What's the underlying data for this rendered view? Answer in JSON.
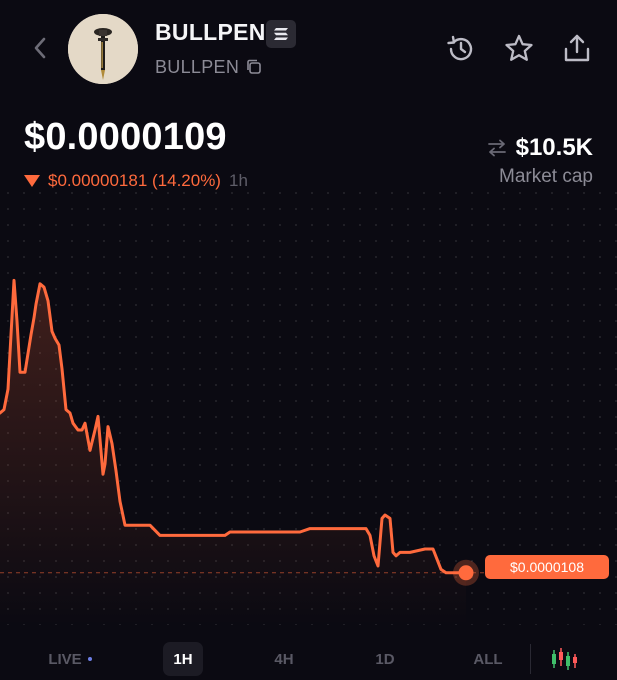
{
  "header": {
    "token_name": "BULLPEN",
    "token_symbol": "BULLPEN",
    "icons": [
      "back-chevron-icon",
      "chain-badge-icon",
      "copy-icon",
      "history-icon",
      "star-icon",
      "share-icon"
    ]
  },
  "price": {
    "current": "$0.0000109",
    "change": "$0.00000181 (14.20%)",
    "timeframe": "1h",
    "direction": "down"
  },
  "market_cap": {
    "value": "$10.5K",
    "label": "Market cap"
  },
  "chart": {
    "last_price_label": "$0.0000108",
    "line_color": "#ff6a3d"
  },
  "chart_data": {
    "type": "line",
    "title": "",
    "xlabel": "",
    "ylabel": "",
    "x": [
      0,
      4,
      8,
      11,
      14,
      17,
      20,
      25,
      31,
      34,
      36,
      40,
      44,
      48,
      52,
      55,
      59,
      62,
      66,
      70,
      73,
      78,
      82,
      85,
      90,
      95,
      98,
      103,
      105,
      108,
      112,
      116,
      120,
      125,
      130,
      150,
      160,
      170,
      200,
      225,
      230,
      245,
      300,
      310,
      366,
      370,
      374,
      378,
      382,
      385,
      390,
      393,
      396,
      400,
      403,
      410,
      425,
      433,
      437,
      441,
      446,
      453,
      466
    ],
    "y": [
      1.55,
      1.56,
      1.62,
      1.78,
      1.94,
      1.82,
      1.67,
      1.67,
      1.78,
      1.83,
      1.87,
      1.93,
      1.92,
      1.88,
      1.79,
      1.77,
      1.75,
      1.68,
      1.56,
      1.55,
      1.52,
      1.5,
      1.5,
      1.52,
      1.44,
      1.5,
      1.54,
      1.37,
      1.4,
      1.51,
      1.46,
      1.38,
      1.29,
      1.22,
      1.22,
      1.22,
      1.19,
      1.19,
      1.19,
      1.19,
      1.2,
      1.2,
      1.2,
      1.21,
      1.21,
      1.19,
      1.13,
      1.1,
      1.24,
      1.25,
      1.24,
      1.14,
      1.13,
      1.14,
      1.14,
      1.14,
      1.15,
      1.15,
      1.12,
      1.09,
      1.08,
      1.08,
      1.08
    ],
    "y_unit": "1e-5",
    "grid": true,
    "area_fill": true
  },
  "timeframes": {
    "items": [
      {
        "label": "LIVE",
        "active": false
      },
      {
        "label": "1H",
        "active": true
      },
      {
        "label": "4H",
        "active": false
      },
      {
        "label": "1D",
        "active": false
      },
      {
        "label": "ALL",
        "active": false
      }
    ],
    "chart_toggle_icon": "candlestick-icon"
  }
}
